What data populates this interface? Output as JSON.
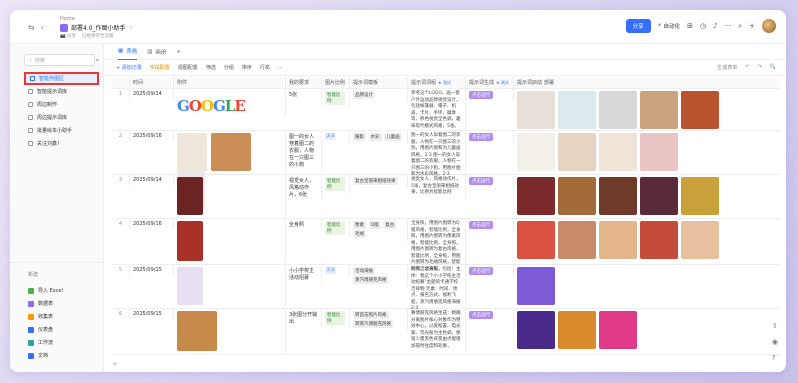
{
  "topbar": {
    "breadcrumb": "Home",
    "title": "部署4.0_作图小助手",
    "star": "☆",
    "sub_items": [
      "📷 分享",
      "已经保存至云端"
    ],
    "share_label": "分享",
    "automation_label": "自动化",
    "nav_back": "⇆",
    "nav_sep": "‹"
  },
  "sidebar": {
    "search_placeholder": "搜索",
    "items": [
      {
        "label": "智能作图区"
      },
      {
        "label": "智能提示词库"
      },
      {
        "label": "周边制作"
      },
      {
        "label": "周边提示词库"
      },
      {
        "label": "批量绘本小助手"
      },
      {
        "label": "关注刘鑫！"
      }
    ],
    "new_label": "新建",
    "new_items": [
      {
        "label": "导入 Excel",
        "color": "#4caf50"
      },
      {
        "label": "数据表",
        "color": "#8b6cf0"
      },
      {
        "label": "收集表",
        "color": "#ff9800"
      },
      {
        "label": "仪表盘",
        "color": "#3370ff"
      },
      {
        "label": "工作流",
        "color": "#26a69a"
      },
      {
        "label": "文档",
        "color": "#3370ff"
      }
    ]
  },
  "tabs": [
    {
      "label": "表格",
      "active": true
    },
    {
      "label": "画册",
      "active": false
    },
    {
      "label": "+",
      "active": false
    }
  ],
  "toolbar": {
    "add_record": "+ 添加记录",
    "field_config": "字段配置",
    "view_config": "视图配置",
    "filter": "筛选",
    "group": "分组",
    "sort": "排序",
    "row_height": "行高",
    "more": "···",
    "right": [
      "生成表单",
      "↶",
      "↷",
      "🔍"
    ]
  },
  "columns": [
    "",
    "时间",
    "附件",
    "我的要求",
    "图片比例",
    "提示词模板",
    "提示词词组",
    "提示词生成",
    "提示词启动",
    "部署"
  ],
  "beta_label": "★ 测试",
  "rows": [
    {
      "num": "1",
      "date": "2025/09/14",
      "request": "5张",
      "ratio": "",
      "template": [
        "品牌设计"
      ],
      "tags_green": [
        "智能比例"
      ],
      "desc": "参考这个LOGO，画一套户外运动品牌视觉设计，包括帐篷展、帽子、机盖、卡片、手环、徽章等，移色视觉全色调，趣味现代模式风格，5张。",
      "btn": "点击运行",
      "attachment_text": "GOOGLE",
      "gen_colors": [
        "#e8e0d8",
        "#dce9ee",
        "#d8d8d8",
        "#c9a27e",
        "#b8532e"
      ]
    },
    {
      "num": "2",
      "date": "2025/09/16",
      "request": "图一的女人穿着图二的衣服，人物在一只图三的小狗",
      "ratio": "2:3",
      "template": [
        "摄影",
        "水彩",
        "儿童画"
      ],
      "tags_green": [],
      "desc": "图一的女人穿着图二的衣服，人物在一只图三的小狗，用图片图和为儿童画风格，2:3\n图一的女人穿着图二的衣服，人物在一只图三的小狗，用图片图和为水彩风格，2:3",
      "btn": "点击运行",
      "attachment_text": "",
      "gen_colors": [
        "#f3efe9",
        "#e6d4c0",
        "#f0e3d8",
        "#e9c4c4"
      ]
    },
    {
      "num": "3",
      "date": "2025/09/14",
      "request": "视觉女人，风格动作片，6张",
      "ratio": "",
      "template": [
        "复古宝丽来相纸效果"
      ],
      "tags_green": [
        "智能比例"
      ],
      "desc": "视觉女人，风格动作片，5张，复古宝丽来相纸效果，比例为智能比例",
      "btn": "点击运行",
      "attachment_text": "",
      "gen_colors": [
        "#7a2a2a",
        "#a46b3a",
        "#6e3b2a",
        "#5a2a3a",
        "#c9a13a"
      ]
    },
    {
      "num": "4",
      "date": "2025/09/16",
      "request": "全身照",
      "ratio": "",
      "template": [
        "像素",
        "Q版",
        "复古",
        "毛绒"
      ],
      "tags_green": [
        "智能比例"
      ],
      "desc": "全身照，用图片图转为Q版风格，智能比例，全身照，用图片图转为像素风格，智能比例，全身照，用图片图转为复古风格，智能比例，全身照，用图片图转为毛绒风格，智能比例，全身照，",
      "btn": "点击运行",
      "attachment_text": "",
      "gen_colors": [
        "#d85040",
        "#c98a6a",
        "#e2b58a",
        "#c44a3a",
        "#e7c0a0"
      ]
    },
    {
      "num": "5",
      "date": "2025/09/15",
      "request": "小小学校主活动招募",
      "ratio": "2:3",
      "template": [
        "活动海报",
        "蒸汽博朋克风格"
      ],
      "tags_green": [],
      "desc": "制作活动海报，包括：主体：我这个小小学校主活动招募\"主题的卡通学校吉祥物\n元素：时间、地点、报名方式、福利飞船，蒸汽博朋克风格海报2:3",
      "btn": "点击运行",
      "attachment_text": "",
      "gen_colors": [
        "#7b5cd6"
      ]
    },
    {
      "num": "6",
      "date": "2025/09/15",
      "request": "3张图分开输出",
      "ratio": "",
      "template": [
        "转首志照片风格",
        "转蒸汽博朋克风格"
      ],
      "tags_green": [
        "智能比例"
      ],
      "desc": "赛博朋克风格生成：精确分离图片核心对象作为特效中心，以宽松置、电光紫、荧光粉为主色调，保留少量黑色背景由点缀增加夜时往度和轮廓，",
      "btn": "点击运行",
      "attachment_text": "",
      "gen_colors": [
        "#4a2a8a",
        "#d98a2a",
        "#e03a8a"
      ]
    }
  ]
}
